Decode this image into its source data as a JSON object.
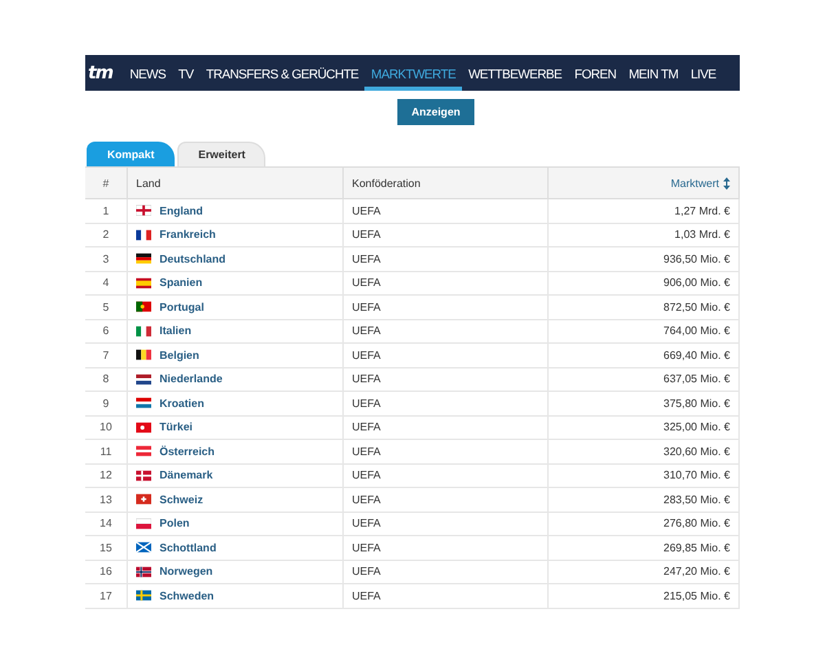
{
  "nav": {
    "logo": "tm",
    "items": [
      {
        "label": "NEWS",
        "selected": false
      },
      {
        "label": "TV",
        "selected": false
      },
      {
        "label": "TRANSFERS & GERÜCHTE",
        "selected": false
      },
      {
        "label": "MARKTWERTE",
        "selected": true
      },
      {
        "label": "WETTBEWERBE",
        "selected": false
      },
      {
        "label": "FOREN",
        "selected": false
      },
      {
        "label": "MEIN TM",
        "selected": false
      },
      {
        "label": "LIVE",
        "selected": false
      }
    ]
  },
  "show_button": "Anzeigen",
  "tabs": [
    {
      "label": "Kompakt",
      "selected": true
    },
    {
      "label": "Erweitert",
      "selected": false
    }
  ],
  "table": {
    "columns": [
      "#",
      "Land",
      "Konföderation",
      "Marktwert"
    ],
    "rows": [
      {
        "rank": "1",
        "country": "England",
        "confederation": "UEFA",
        "value": "1,27 Mrd. €"
      },
      {
        "rank": "2",
        "country": "Frankreich",
        "confederation": "UEFA",
        "value": "1,03 Mrd. €"
      },
      {
        "rank": "3",
        "country": "Deutschland",
        "confederation": "UEFA",
        "value": "936,50 Mio. €"
      },
      {
        "rank": "4",
        "country": "Spanien",
        "confederation": "UEFA",
        "value": "906,00 Mio. €"
      },
      {
        "rank": "5",
        "country": "Portugal",
        "confederation": "UEFA",
        "value": "872,50 Mio. €"
      },
      {
        "rank": "6",
        "country": "Italien",
        "confederation": "UEFA",
        "value": "764,00 Mio. €"
      },
      {
        "rank": "7",
        "country": "Belgien",
        "confederation": "UEFA",
        "value": "669,40 Mio. €"
      },
      {
        "rank": "8",
        "country": "Niederlande",
        "confederation": "UEFA",
        "value": "637,05 Mio. €"
      },
      {
        "rank": "9",
        "country": "Kroatien",
        "confederation": "UEFA",
        "value": "375,80 Mio. €"
      },
      {
        "rank": "10",
        "country": "Türkei",
        "confederation": "UEFA",
        "value": "325,00 Mio. €"
      },
      {
        "rank": "11",
        "country": "Österreich",
        "confederation": "UEFA",
        "value": "320,60 Mio. €"
      },
      {
        "rank": "12",
        "country": "Dänemark",
        "confederation": "UEFA",
        "value": "310,70 Mio. €"
      },
      {
        "rank": "13",
        "country": "Schweiz",
        "confederation": "UEFA",
        "value": "283,50 Mio. €"
      },
      {
        "rank": "14",
        "country": "Polen",
        "confederation": "UEFA",
        "value": "276,80 Mio. €"
      },
      {
        "rank": "15",
        "country": "Schottland",
        "confederation": "UEFA",
        "value": "269,85 Mio. €"
      },
      {
        "rank": "16",
        "country": "Norwegen",
        "confederation": "UEFA",
        "value": "247,20 Mio. €"
      },
      {
        "rank": "17",
        "country": "Schweden",
        "confederation": "UEFA",
        "value": "215,05 Mio. €"
      }
    ]
  }
}
